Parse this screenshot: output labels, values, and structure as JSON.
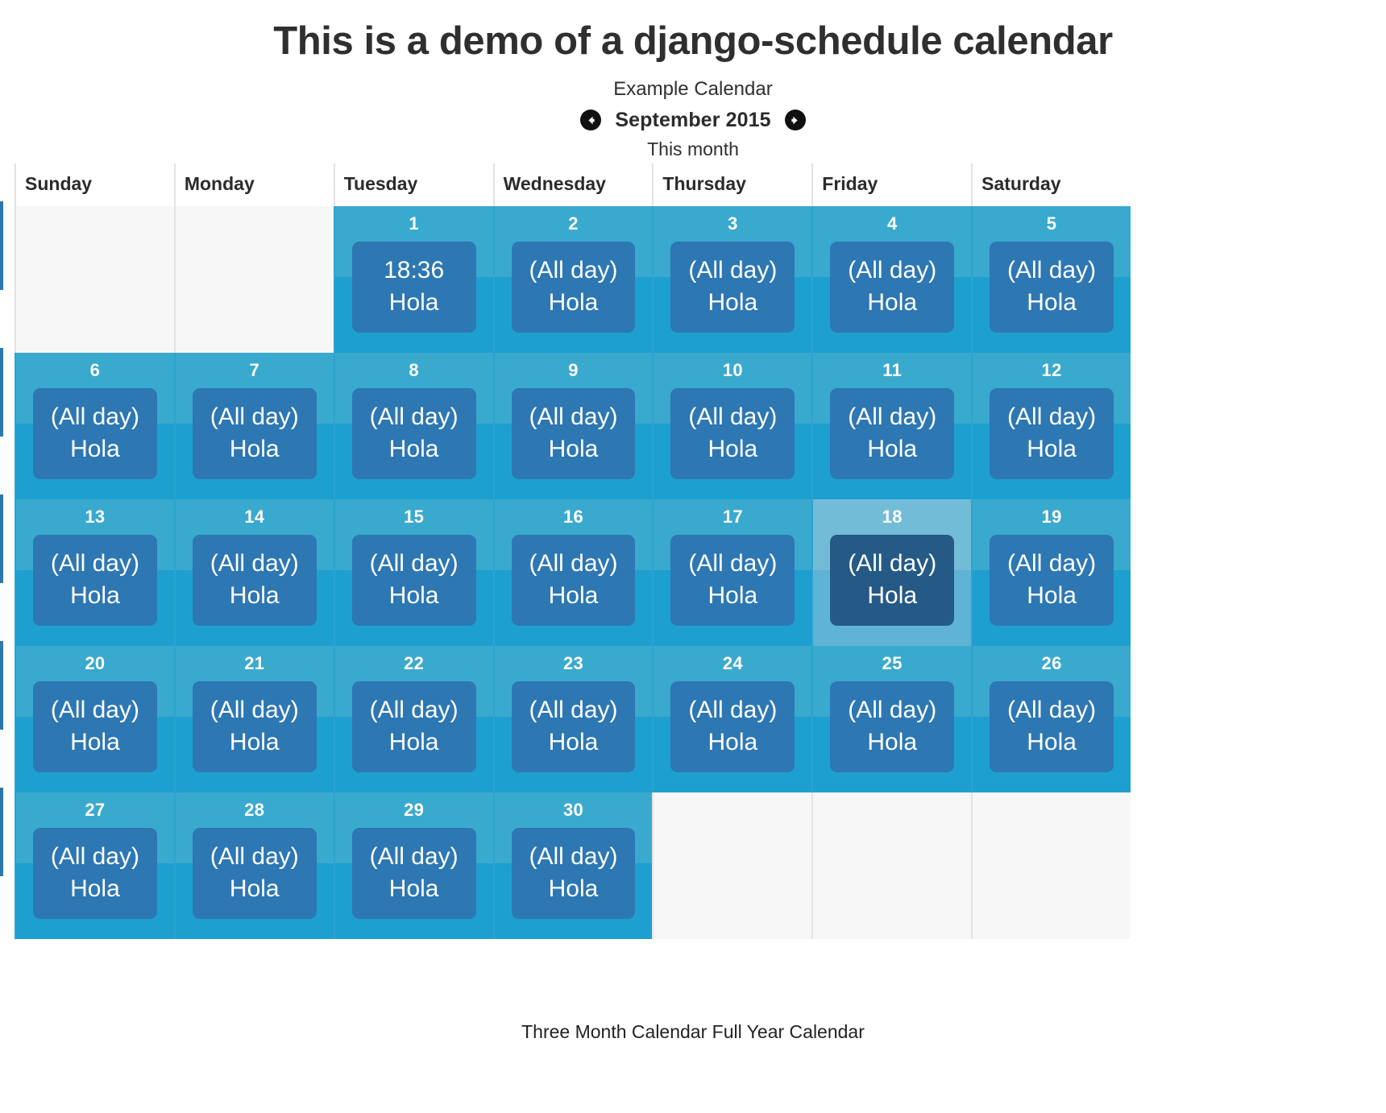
{
  "header": {
    "title": "This is a demo of a django-schedule calendar",
    "calendar_name": "Example Calendar",
    "month_label": "September 2015",
    "this_month_label": "This month",
    "prev_icon": "arrow-left-circle-icon",
    "next_icon": "arrow-right-circle-icon"
  },
  "weekdays": [
    "Sunday",
    "Monday",
    "Tuesday",
    "Wednesday",
    "Thursday",
    "Friday",
    "Saturday"
  ],
  "colors": {
    "cell_top": "#3aa9ce",
    "cell_bottom": "#1d9fd0",
    "event": "#2d77b3",
    "today_cell_top": "#73bcd8",
    "today_cell_bottom": "#5fb4d6",
    "today_event": "#255a86",
    "empty_cell": "#f7f7f7",
    "text": "#2b2b2b"
  },
  "weeks": [
    [
      {
        "state": "empty"
      },
      {
        "state": "empty"
      },
      {
        "state": "filled",
        "day": "1",
        "time": "18:36",
        "event": "Hola"
      },
      {
        "state": "filled",
        "day": "2",
        "time": "(All day)",
        "event": "Hola"
      },
      {
        "state": "filled",
        "day": "3",
        "time": "(All day)",
        "event": "Hola"
      },
      {
        "state": "filled",
        "day": "4",
        "time": "(All day)",
        "event": "Hola"
      },
      {
        "state": "filled",
        "day": "5",
        "time": "(All day)",
        "event": "Hola"
      }
    ],
    [
      {
        "state": "filled",
        "day": "6",
        "time": "(All day)",
        "event": "Hola"
      },
      {
        "state": "filled",
        "day": "7",
        "time": "(All day)",
        "event": "Hola"
      },
      {
        "state": "filled",
        "day": "8",
        "time": "(All day)",
        "event": "Hola"
      },
      {
        "state": "filled",
        "day": "9",
        "time": "(All day)",
        "event": "Hola"
      },
      {
        "state": "filled",
        "day": "10",
        "time": "(All day)",
        "event": "Hola"
      },
      {
        "state": "filled",
        "day": "11",
        "time": "(All day)",
        "event": "Hola"
      },
      {
        "state": "filled",
        "day": "12",
        "time": "(All day)",
        "event": "Hola"
      }
    ],
    [
      {
        "state": "filled",
        "day": "13",
        "time": "(All day)",
        "event": "Hola"
      },
      {
        "state": "filled",
        "day": "14",
        "time": "(All day)",
        "event": "Hola"
      },
      {
        "state": "filled",
        "day": "15",
        "time": "(All day)",
        "event": "Hola"
      },
      {
        "state": "filled",
        "day": "16",
        "time": "(All day)",
        "event": "Hola"
      },
      {
        "state": "filled",
        "day": "17",
        "time": "(All day)",
        "event": "Hola"
      },
      {
        "state": "today",
        "day": "18",
        "time": "(All day)",
        "event": "Hola"
      },
      {
        "state": "filled",
        "day": "19",
        "time": "(All day)",
        "event": "Hola"
      }
    ],
    [
      {
        "state": "filled",
        "day": "20",
        "time": "(All day)",
        "event": "Hola"
      },
      {
        "state": "filled",
        "day": "21",
        "time": "(All day)",
        "event": "Hola"
      },
      {
        "state": "filled",
        "day": "22",
        "time": "(All day)",
        "event": "Hola"
      },
      {
        "state": "filled",
        "day": "23",
        "time": "(All day)",
        "event": "Hola"
      },
      {
        "state": "filled",
        "day": "24",
        "time": "(All day)",
        "event": "Hola"
      },
      {
        "state": "filled",
        "day": "25",
        "time": "(All day)",
        "event": "Hola"
      },
      {
        "state": "filled",
        "day": "26",
        "time": "(All day)",
        "event": "Hola"
      }
    ],
    [
      {
        "state": "filled",
        "day": "27",
        "time": "(All day)",
        "event": "Hola"
      },
      {
        "state": "filled",
        "day": "28",
        "time": "(All day)",
        "event": "Hola"
      },
      {
        "state": "filled",
        "day": "29",
        "time": "(All day)",
        "event": "Hola"
      },
      {
        "state": "filled",
        "day": "30",
        "time": "(All day)",
        "event": "Hola"
      },
      {
        "state": "empty"
      },
      {
        "state": "empty"
      },
      {
        "state": "empty"
      }
    ]
  ],
  "footer": {
    "three_month_label": "Three Month Calendar",
    "full_year_label": "Full Year Calendar"
  }
}
